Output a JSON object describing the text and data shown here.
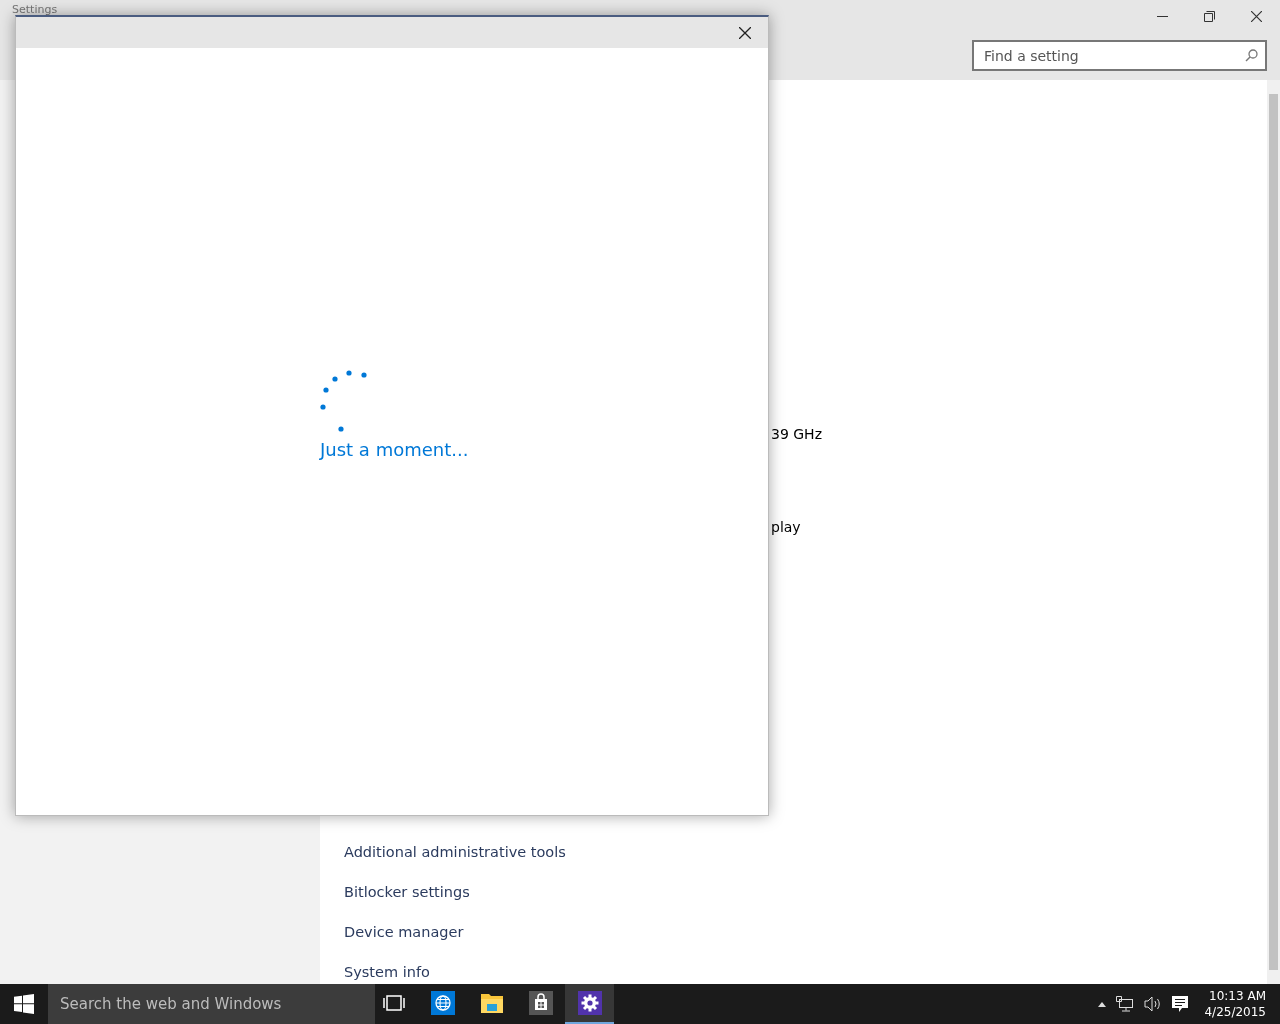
{
  "window": {
    "title": "Settings",
    "search": {
      "placeholder": "Find a setting"
    }
  },
  "content": {
    "details": [
      "39 GHz",
      "play"
    ],
    "related_links": [
      "Additional administrative tools",
      "Bitlocker settings",
      "Device manager",
      "System info"
    ]
  },
  "dialog": {
    "message": "Just a moment..."
  },
  "taskbar": {
    "search_placeholder": "Search the web and Windows",
    "apps": [
      {
        "kind": "task-view",
        "selected": false
      },
      {
        "kind": "browser",
        "selected": false
      },
      {
        "kind": "explorer",
        "selected": false
      },
      {
        "kind": "store",
        "selected": false
      },
      {
        "kind": "settings",
        "selected": true
      }
    ],
    "time": "10:13 AM",
    "date": "4/25/2015"
  }
}
